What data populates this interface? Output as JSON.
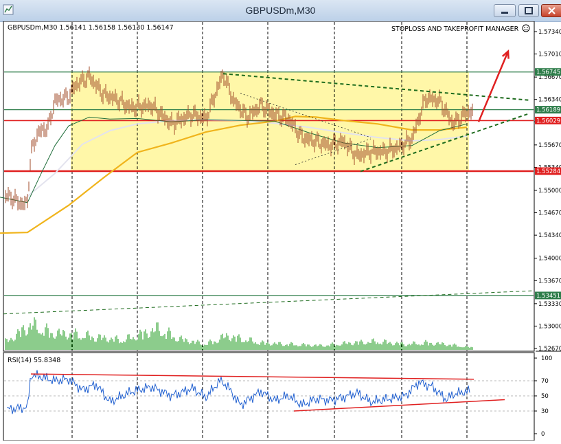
{
  "window": {
    "title": "GBPUSDm,M30",
    "icons": {
      "app": "chart-icon",
      "minimize": "minimize-icon",
      "maximize": "maximize-icon",
      "close": "close-icon"
    }
  },
  "price_panel": {
    "header": "GBPUSDm,M30  1.56141 1.56158 1.56130 1.56147",
    "indicator_title": "STOPLOSS AND TAKEPROFIT MANAGER",
    "price_ticks": [
      "1.57340",
      "1.57010",
      "1.56670",
      "1.56340",
      "1.56010",
      "1.55670",
      "1.55340",
      "1.55000",
      "1.54670",
      "1.54340",
      "1.54000",
      "1.53670",
      "1.53330",
      "1.53000",
      "1.52670"
    ],
    "level_labels": [
      {
        "price": 1.56745,
        "text": "1.56745",
        "color": "#2e7d4a"
      },
      {
        "price": 1.56189,
        "text": "1.56189",
        "color": "#2e7d4a"
      },
      {
        "price": 1.56029,
        "text": "1.56029",
        "color": "#e02020"
      },
      {
        "price": 1.55284,
        "text": "1.55284",
        "color": "#e02020"
      },
      {
        "price": 1.53451,
        "text": "1.53451",
        "color": "#2e7d4a"
      }
    ],
    "range_box": {
      "price_top": 1.56745,
      "price_bottom": 1.55284,
      "color": "#fff7a8"
    }
  },
  "rsi_panel": {
    "header": "RSI(14) 55.8348",
    "ticks": [
      "100",
      "70",
      "50",
      "30",
      "0"
    ],
    "tick_values": [
      100,
      70,
      50,
      30,
      0
    ],
    "levels": [
      70,
      50,
      30
    ]
  },
  "chart_data": {
    "type": "line",
    "symbol": "GBPUSDm",
    "timeframe": "M30",
    "ylim": [
      1.5258,
      1.5752
    ],
    "last_ohlc": {
      "open": 1.56141,
      "high": 1.56158,
      "low": 1.5613,
      "close": 1.56147
    },
    "price_series": {
      "x": [
        0,
        15,
        35,
        40,
        45,
        55,
        70,
        80,
        100,
        110,
        130,
        150,
        170,
        190,
        220,
        250,
        280,
        300,
        325,
        340,
        360,
        380,
        400,
        420,
        440,
        460,
        480,
        500,
        520,
        540,
        560,
        580,
        600,
        620,
        640,
        660,
        680
      ],
      "y": [
        1.5495,
        1.549,
        1.5478,
        1.5485,
        1.5555,
        1.5585,
        1.5593,
        1.5632,
        1.5638,
        1.5655,
        1.5668,
        1.5642,
        1.5634,
        1.5622,
        1.5625,
        1.5598,
        1.5612,
        1.5606,
        1.5672,
        1.5632,
        1.5608,
        1.5625,
        1.5612,
        1.5605,
        1.5578,
        1.5572,
        1.5566,
        1.5572,
        1.5551,
        1.5557,
        1.5557,
        1.5563,
        1.5576,
        1.5636,
        1.5632,
        1.5598,
        1.5615
      ]
    },
    "sma_slow": {
      "x": [
        0,
        40,
        100,
        150,
        200,
        250,
        300,
        350,
        400,
        430,
        460,
        500,
        550,
        600,
        640,
        680
      ],
      "y": [
        1.5437,
        1.5438,
        1.5478,
        1.5518,
        1.5556,
        1.557,
        1.5586,
        1.5596,
        1.5602,
        1.5609,
        1.5608,
        1.5603,
        1.5598,
        1.5589,
        1.5589,
        1.5593
      ]
    },
    "ema_fast": {
      "x": [
        0,
        40,
        60,
        80,
        100,
        130,
        160,
        200,
        250,
        300,
        350,
        400,
        450,
        500,
        550,
        600,
        640,
        680
      ],
      "y": [
        1.549,
        1.5482,
        1.5525,
        1.5566,
        1.5595,
        1.5608,
        1.5605,
        1.5606,
        1.5601,
        1.5604,
        1.5603,
        1.5602,
        1.5585,
        1.557,
        1.5563,
        1.5566,
        1.5588,
        1.5598
      ]
    },
    "ma_white": {
      "x": [
        40,
        80,
        120,
        160,
        200,
        250,
        300,
        350,
        400,
        450,
        500,
        550,
        600,
        640,
        680
      ],
      "y": [
        1.5491,
        1.5525,
        1.5568,
        1.5588,
        1.5598,
        1.5603,
        1.5604,
        1.5603,
        1.5599,
        1.5593,
        1.5585,
        1.5578,
        1.5573,
        1.5575,
        1.558
      ]
    },
    "volume": {
      "x": [
        10,
        45,
        75,
        110,
        140,
        180,
        230,
        260,
        300,
        330,
        380,
        420,
        470,
        510,
        550,
        590,
        620,
        650,
        680
      ],
      "y": [
        0.3,
        0.9,
        0.6,
        0.55,
        0.45,
        0.35,
        0.75,
        0.4,
        0.2,
        0.5,
        0.25,
        0.2,
        0.15,
        0.25,
        0.3,
        0.2,
        0.25,
        0.2,
        0.1
      ]
    },
    "rsi": {
      "x": [
        10,
        40,
        45,
        60,
        80,
        100,
        120,
        140,
        160,
        190,
        220,
        250,
        280,
        300,
        320,
        330,
        350,
        380,
        400,
        420,
        440,
        460,
        480,
        500,
        520,
        540,
        560,
        590,
        610,
        630,
        650,
        660,
        680
      ],
      "y": [
        32,
        35,
        78,
        75,
        70,
        72,
        58,
        65,
        42,
        55,
        62,
        50,
        60,
        48,
        70,
        64,
        38,
        56,
        44,
        50,
        38,
        46,
        44,
        48,
        54,
        42,
        45,
        50,
        68,
        62,
        45,
        52,
        56
      ]
    },
    "trendlines": [
      {
        "id": "upper-falling",
        "x": [
          325,
          770
        ],
        "y": [
          1.5672,
          1.5633
        ],
        "color": "#1d6b1d",
        "style": "dashed"
      },
      {
        "id": "lower-rising",
        "x": [
          525,
          770
        ],
        "y": [
          1.5528,
          1.5613
        ],
        "color": "#1d6b1d",
        "style": "dashed"
      },
      {
        "id": "inner-top",
        "x": [
          350,
          540
        ],
        "y": [
          1.5643,
          1.5578
        ],
        "color": "#2b2b2b",
        "style": "dotted"
      },
      {
        "id": "inner-bottom",
        "x": [
          430,
          540
        ],
        "y": [
          1.5538,
          1.5576
        ],
        "color": "#2b2b2b",
        "style": "dotted"
      },
      {
        "id": "long-term-support",
        "x": [
          5,
          775
        ],
        "y": [
          1.5318,
          1.5352
        ],
        "color": "#1d6b1d",
        "style": "dashed"
      }
    ],
    "rsi_trendlines": [
      {
        "x": [
          45,
          690
        ],
        "y": [
          79,
          72
        ],
        "color": "#e02020"
      },
      {
        "x": [
          428,
          735
        ],
        "y": [
          30,
          45
        ],
        "color": "#e02020"
      }
    ],
    "arrow": {
      "x": [
        697,
        740
      ],
      "y": [
        1.5601,
        1.5705
      ],
      "color": "#e02020"
    },
    "vertical_gridlines_x": [
      105,
      200,
      295,
      390,
      487,
      585,
      680
    ],
    "rsi_ylim": [
      0,
      100
    ]
  }
}
